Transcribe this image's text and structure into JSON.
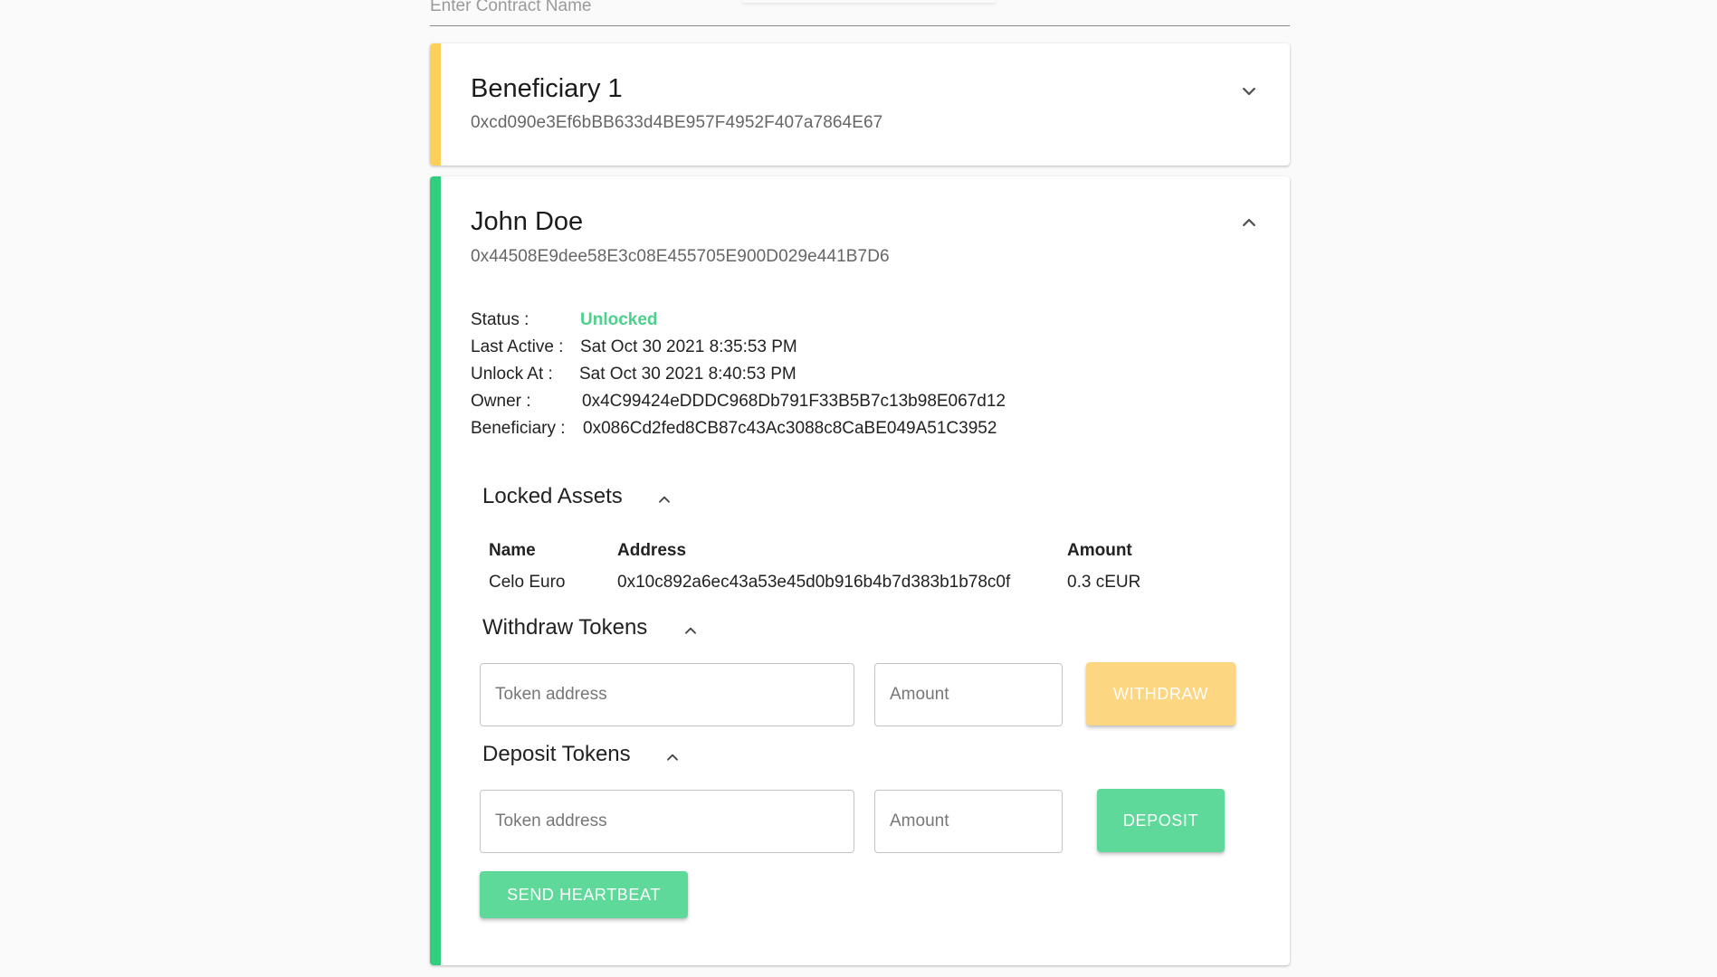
{
  "colors": {
    "accent_yellow": "#ffcf5c",
    "accent_green": "#32cd7e",
    "button_yellow": "#fcd680",
    "button_green": "#5fd99a",
    "status_green": "#4cd08b"
  },
  "contract_name": {
    "placeholder": "Enter Contract Name",
    "value": ""
  },
  "cards": [
    {
      "title": "Beneficiary 1",
      "address": "0xcd090e3Ef6bBB633d4BE957F4952F407a7864E67",
      "expanded": false,
      "toggle_icon": "chevron-down-icon"
    },
    {
      "title": "John Doe",
      "address": "0x44508E9dee58E3c08E455705E900D029e441B7D6",
      "expanded": true,
      "toggle_icon": "chevron-up-icon",
      "details": {
        "status_label": "Status :",
        "status_value": "Unlocked",
        "last_active_label": "Last Active :",
        "last_active_value": "Sat Oct 30 2021 8:35:53 PM",
        "unlock_at_label": "Unlock At :",
        "unlock_at_value": "Sat Oct 30 2021 8:40:53 PM",
        "owner_label": "Owner :",
        "owner_value": "0x4C99424eDDDC968Db791F33B5B7c13b98E067d12",
        "beneficiary_label": "Beneficiary :",
        "beneficiary_value": "0x086Cd2fed8CB87c43Ac3088c8CaBE049A51C3952"
      },
      "locked_assets": {
        "title": "Locked Assets",
        "toggle_icon": "chevron-up-icon",
        "columns": [
          "Name",
          "Address",
          "Amount"
        ],
        "rows": [
          [
            "Celo Euro",
            "0x10c892a6ec43a53e45d0b916b4b7d383b1b78c0f",
            "0.3 cEUR"
          ]
        ]
      },
      "withdraw": {
        "title": "Withdraw Tokens",
        "toggle_icon": "chevron-up-icon",
        "token_placeholder": "Token address",
        "token_value": "",
        "amount_placeholder": "Amount",
        "amount_value": "",
        "button_label": "WITHDRAW"
      },
      "deposit": {
        "title": "Deposit Tokens",
        "toggle_icon": "chevron-up-icon",
        "token_placeholder": "Token address",
        "token_value": "",
        "amount_placeholder": "Amount",
        "amount_value": "",
        "button_label": "DEPOSIT"
      },
      "heartbeat_button_label": "SEND HEARTBEAT"
    }
  ]
}
